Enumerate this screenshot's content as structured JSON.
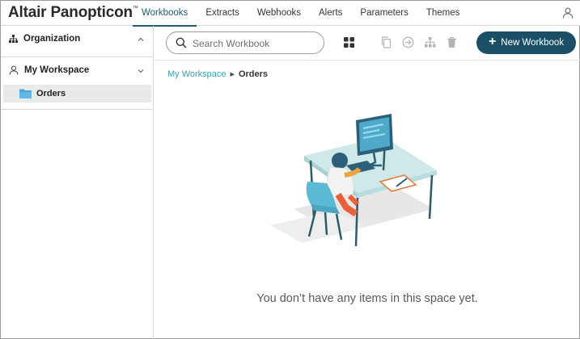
{
  "app": {
    "brand": "Altair Panopticon",
    "trademark": "™"
  },
  "nav": {
    "tabs": [
      {
        "label": "Workbooks",
        "active": true
      },
      {
        "label": "Extracts",
        "active": false
      },
      {
        "label": "Webhooks",
        "active": false
      },
      {
        "label": "Alerts",
        "active": false
      },
      {
        "label": "Parameters",
        "active": false
      },
      {
        "label": "Themes",
        "active": false
      }
    ]
  },
  "sidebar": {
    "organization": {
      "label": "Organization",
      "icon": "hierarchy-icon",
      "expanded": false
    },
    "workspace": {
      "label": "My Workspace",
      "icon": "user-icon",
      "expanded": true,
      "items": [
        {
          "label": "Orders",
          "icon": "folder-icon",
          "selected": true
        }
      ]
    }
  },
  "toolbar": {
    "search_placeholder": "Search Workbook",
    "icons": [
      "grid-view-icon",
      "copy-icon",
      "move-icon",
      "hierarchy-icon",
      "trash-icon"
    ],
    "new_label": "New Workbook"
  },
  "breadcrumb": {
    "parent": "My Workspace",
    "current": "Orders"
  },
  "empty_state": {
    "message": "You don’t have any items in this space yet."
  },
  "colors": {
    "accent": "#1b4f67",
    "link": "#3aa0b0",
    "active_tab": "#1e5a72"
  }
}
